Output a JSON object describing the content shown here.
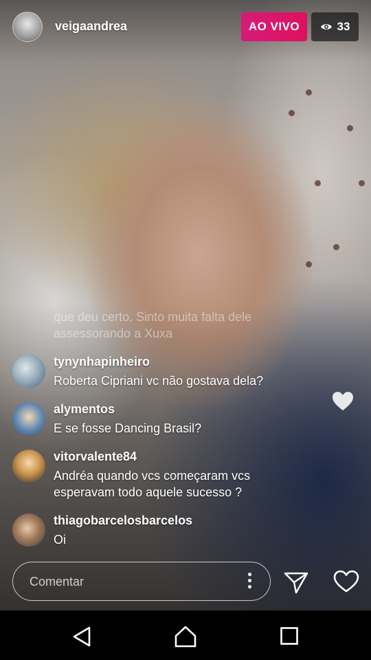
{
  "header": {
    "username": "veigaandrea",
    "live_label": "AO VIVO",
    "viewer_count": "33"
  },
  "fading_comment": "que deu certo. Sinto muita falta dele assessorando a Xuxa",
  "comments": [
    {
      "user": "tynynhapinheiro",
      "text": "Roberta Cipriani  vc não gostava  dela?"
    },
    {
      "user": "alymentos",
      "text": "E se fosse Dancing Brasil?"
    },
    {
      "user": "vitorvalente84",
      "text": "Andréa quando vcs começaram vcs esperavam todo aquele sucesso ?"
    },
    {
      "user": "thiagobarcelosbarcelos",
      "text": "Oi"
    }
  ],
  "composer": {
    "placeholder": "Comentar"
  },
  "icons": {
    "viewer": "eye-icon",
    "more": "more-vertical-icon",
    "send": "send-icon",
    "like": "heart-icon",
    "floating": "heart-icon",
    "nav_back": "back-triangle-icon",
    "nav_home": "home-icon",
    "nav_recent": "recent-apps-icon"
  },
  "colors": {
    "live_badge": "#e0105f",
    "viewer_badge": "#1e1e1e",
    "text": "#ffffff"
  }
}
